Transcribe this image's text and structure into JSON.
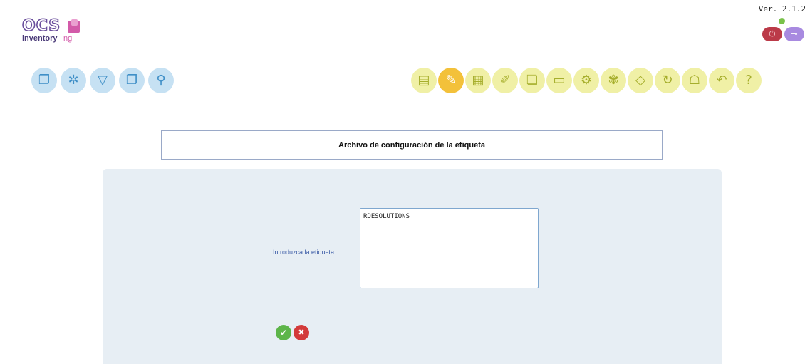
{
  "header": {
    "logo": {
      "brand": "OCS",
      "product": "inventory",
      "suffix": "ng"
    },
    "version": "Ver. 2.1.2",
    "power_icon": "power-icon",
    "key_icon": "key-icon"
  },
  "nav_left": [
    {
      "name": "nav-computers-icon",
      "glyph": "❐"
    },
    {
      "name": "nav-network-icon",
      "glyph": "✲"
    },
    {
      "name": "nav-filter-icon",
      "glyph": "▽"
    },
    {
      "name": "nav-groups-icon",
      "glyph": "❐"
    },
    {
      "name": "nav-search-icon",
      "glyph": "⚲"
    }
  ],
  "nav_right": [
    {
      "name": "nav-inventory-icon",
      "glyph": "▤"
    },
    {
      "name": "nav-config-icon",
      "glyph": "✎",
      "active": true
    },
    {
      "name": "nav-deploy-icon",
      "glyph": "▦"
    },
    {
      "name": "nav-documents-icon",
      "glyph": "✐"
    },
    {
      "name": "nav-copy-icon",
      "glyph": "❏"
    },
    {
      "name": "nav-folder-icon",
      "glyph": "▭"
    },
    {
      "name": "nav-computer-icon",
      "glyph": "⚙"
    },
    {
      "name": "nav-plugins-icon",
      "glyph": "✾"
    },
    {
      "name": "nav-tag-icon",
      "glyph": "◇"
    },
    {
      "name": "nav-refresh-icon",
      "glyph": "↻"
    },
    {
      "name": "nav-user-icon",
      "glyph": "☖"
    },
    {
      "name": "nav-back-icon",
      "glyph": "↶"
    },
    {
      "name": "nav-help-icon",
      "glyph": "?"
    }
  ],
  "page": {
    "title": "Archivo de configuración de la etiqueta"
  },
  "form": {
    "label": "Introduzca la etiqueta:",
    "value": "RDESOLUTIONS",
    "ok_glyph": "✔",
    "cancel_glyph": "✖"
  },
  "colors": {
    "nav_left": "#c6e1f3",
    "nav_right": "#f0f0a6",
    "nav_active": "#f3c13a",
    "panel": "#e7eef4"
  }
}
